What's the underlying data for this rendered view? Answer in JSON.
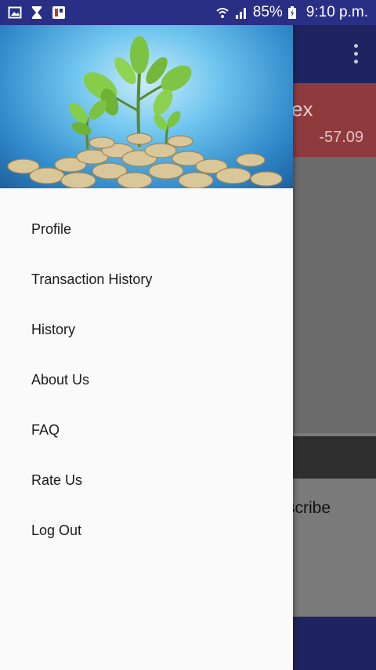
{
  "status_bar": {
    "battery": "85%",
    "time": "9:10 p.m.",
    "icons": [
      "gallery-icon",
      "hourglass-icon",
      "app-notification-icon",
      "wifi-icon",
      "signal-icon",
      "battery-charging-icon"
    ]
  },
  "background": {
    "index_name": "ex",
    "index_change": "-57.09",
    "subscribe_text": "scribe"
  },
  "drawer": {
    "header_image": "plant-growing-from-coins",
    "menu": [
      {
        "label": "Profile"
      },
      {
        "label": "Transaction History"
      },
      {
        "label": "History"
      },
      {
        "label": "About Us"
      },
      {
        "label": "FAQ"
      },
      {
        "label": "Rate Us"
      },
      {
        "label": "Log Out"
      }
    ]
  },
  "colors": {
    "status_bar": "#2a2f86",
    "toolbar": "#1f2460",
    "index_card": "#8f3b3d",
    "drawer_bg": "#fafafa"
  }
}
